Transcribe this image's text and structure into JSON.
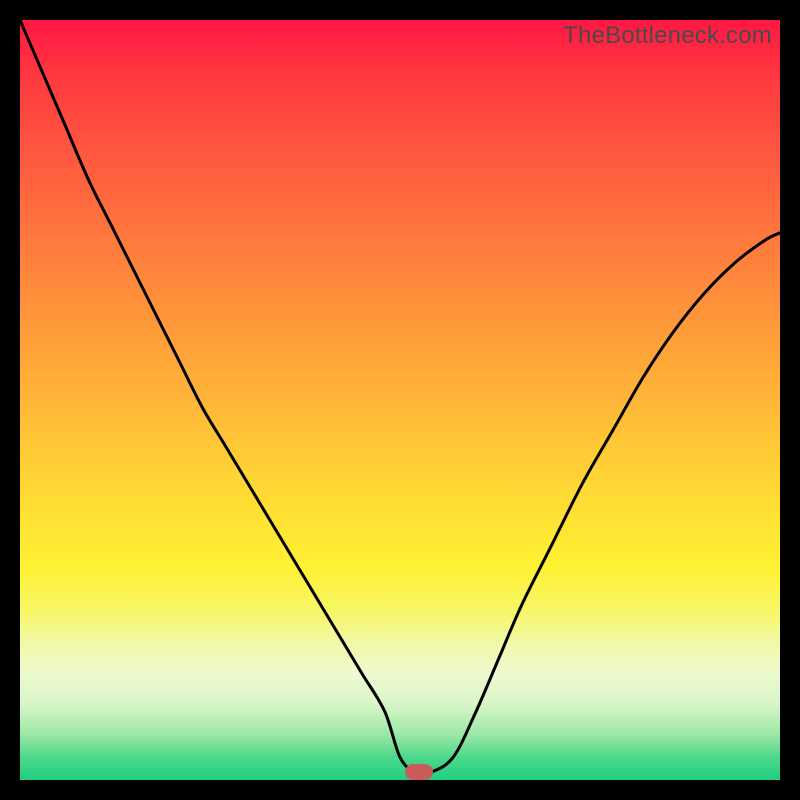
{
  "watermark": "TheBottleneck.com",
  "colors": {
    "frame_background": "#000000",
    "curve_stroke": "#000000",
    "marker_fill": "#c95b5b",
    "gradient_top": "#ff1744",
    "gradient_bottom": "#1fcf83"
  },
  "chart_data": {
    "type": "line",
    "title": "",
    "xlabel": "",
    "ylabel": "",
    "xlim": [
      0,
      100
    ],
    "ylim": [
      0,
      100
    ],
    "grid": false,
    "legend": false,
    "x": [
      0,
      3,
      6,
      9,
      12,
      15,
      18,
      21,
      24,
      27,
      30,
      33,
      36,
      39,
      42,
      45,
      48,
      50,
      52,
      54,
      57,
      60,
      63,
      66,
      70,
      74,
      78,
      82,
      86,
      90,
      94,
      98,
      100
    ],
    "values": [
      100,
      93,
      86,
      79,
      73,
      67,
      61,
      55,
      49,
      44,
      39,
      34,
      29,
      24,
      19,
      14,
      9,
      3,
      1,
      1,
      3,
      9,
      16,
      23,
      31,
      39,
      46,
      53,
      59,
      64,
      68,
      71,
      72
    ],
    "minimum_marker": {
      "x": 52.5,
      "y": 1
    },
    "notes": "Percent-style axes inferred from 0–100 visual range; values estimated from curve shape relative to plot bounds."
  }
}
